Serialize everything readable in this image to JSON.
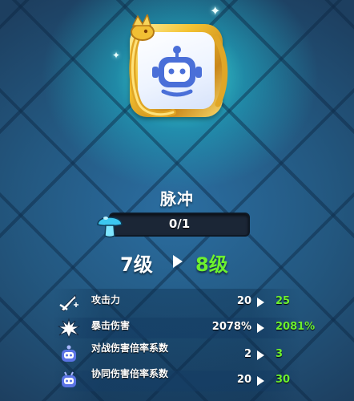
{
  "skill": {
    "name": "脉冲",
    "progress_text": "0/1",
    "progress_fraction": 0
  },
  "level": {
    "from": "7级",
    "to": "8级"
  },
  "stats": [
    {
      "icon": "attack-sword-icon",
      "name": "攻击力",
      "from": "20",
      "to": "25"
    },
    {
      "icon": "crit-burst-icon",
      "name": "暴击伤害",
      "from": "2078%",
      "to": "2081%"
    },
    {
      "icon": "robot-icon",
      "name": "对战伤害倍率系数",
      "from": "2",
      "to": "3"
    },
    {
      "icon": "robot-antenna-icon",
      "name": "协同伤害倍率系数",
      "from": "20",
      "to": "30"
    }
  ],
  "colors": {
    "upgrade_green": "#6df12e",
    "gold_frame": "#f3c231",
    "robot_blue": "#4a6fd8"
  }
}
